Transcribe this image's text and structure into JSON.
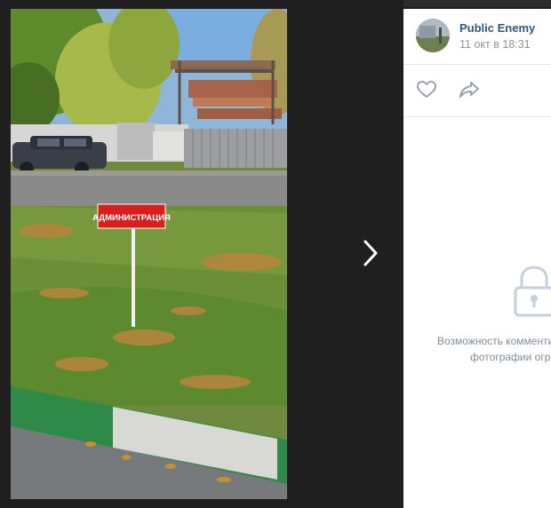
{
  "post": {
    "author": "Public Enemy",
    "date": "11 окт в 18:31"
  },
  "photo": {
    "sign_text": "АДМИНИСТРАЦИЯ"
  },
  "icons": {
    "like": "heart-outline-icon",
    "share": "share-arrow-icon",
    "next": "chevron-right-icon",
    "lock": "lock-icon"
  },
  "comments": {
    "notice_line1": "Возможность комменти",
    "notice_line2": "фотографии огр"
  },
  "colors": {
    "author_link": "#2a5885",
    "muted_text": "#939393",
    "notice_text": "#818c99",
    "viewer_background": "#1f1f1f",
    "sign_red": "#d81f1f"
  }
}
